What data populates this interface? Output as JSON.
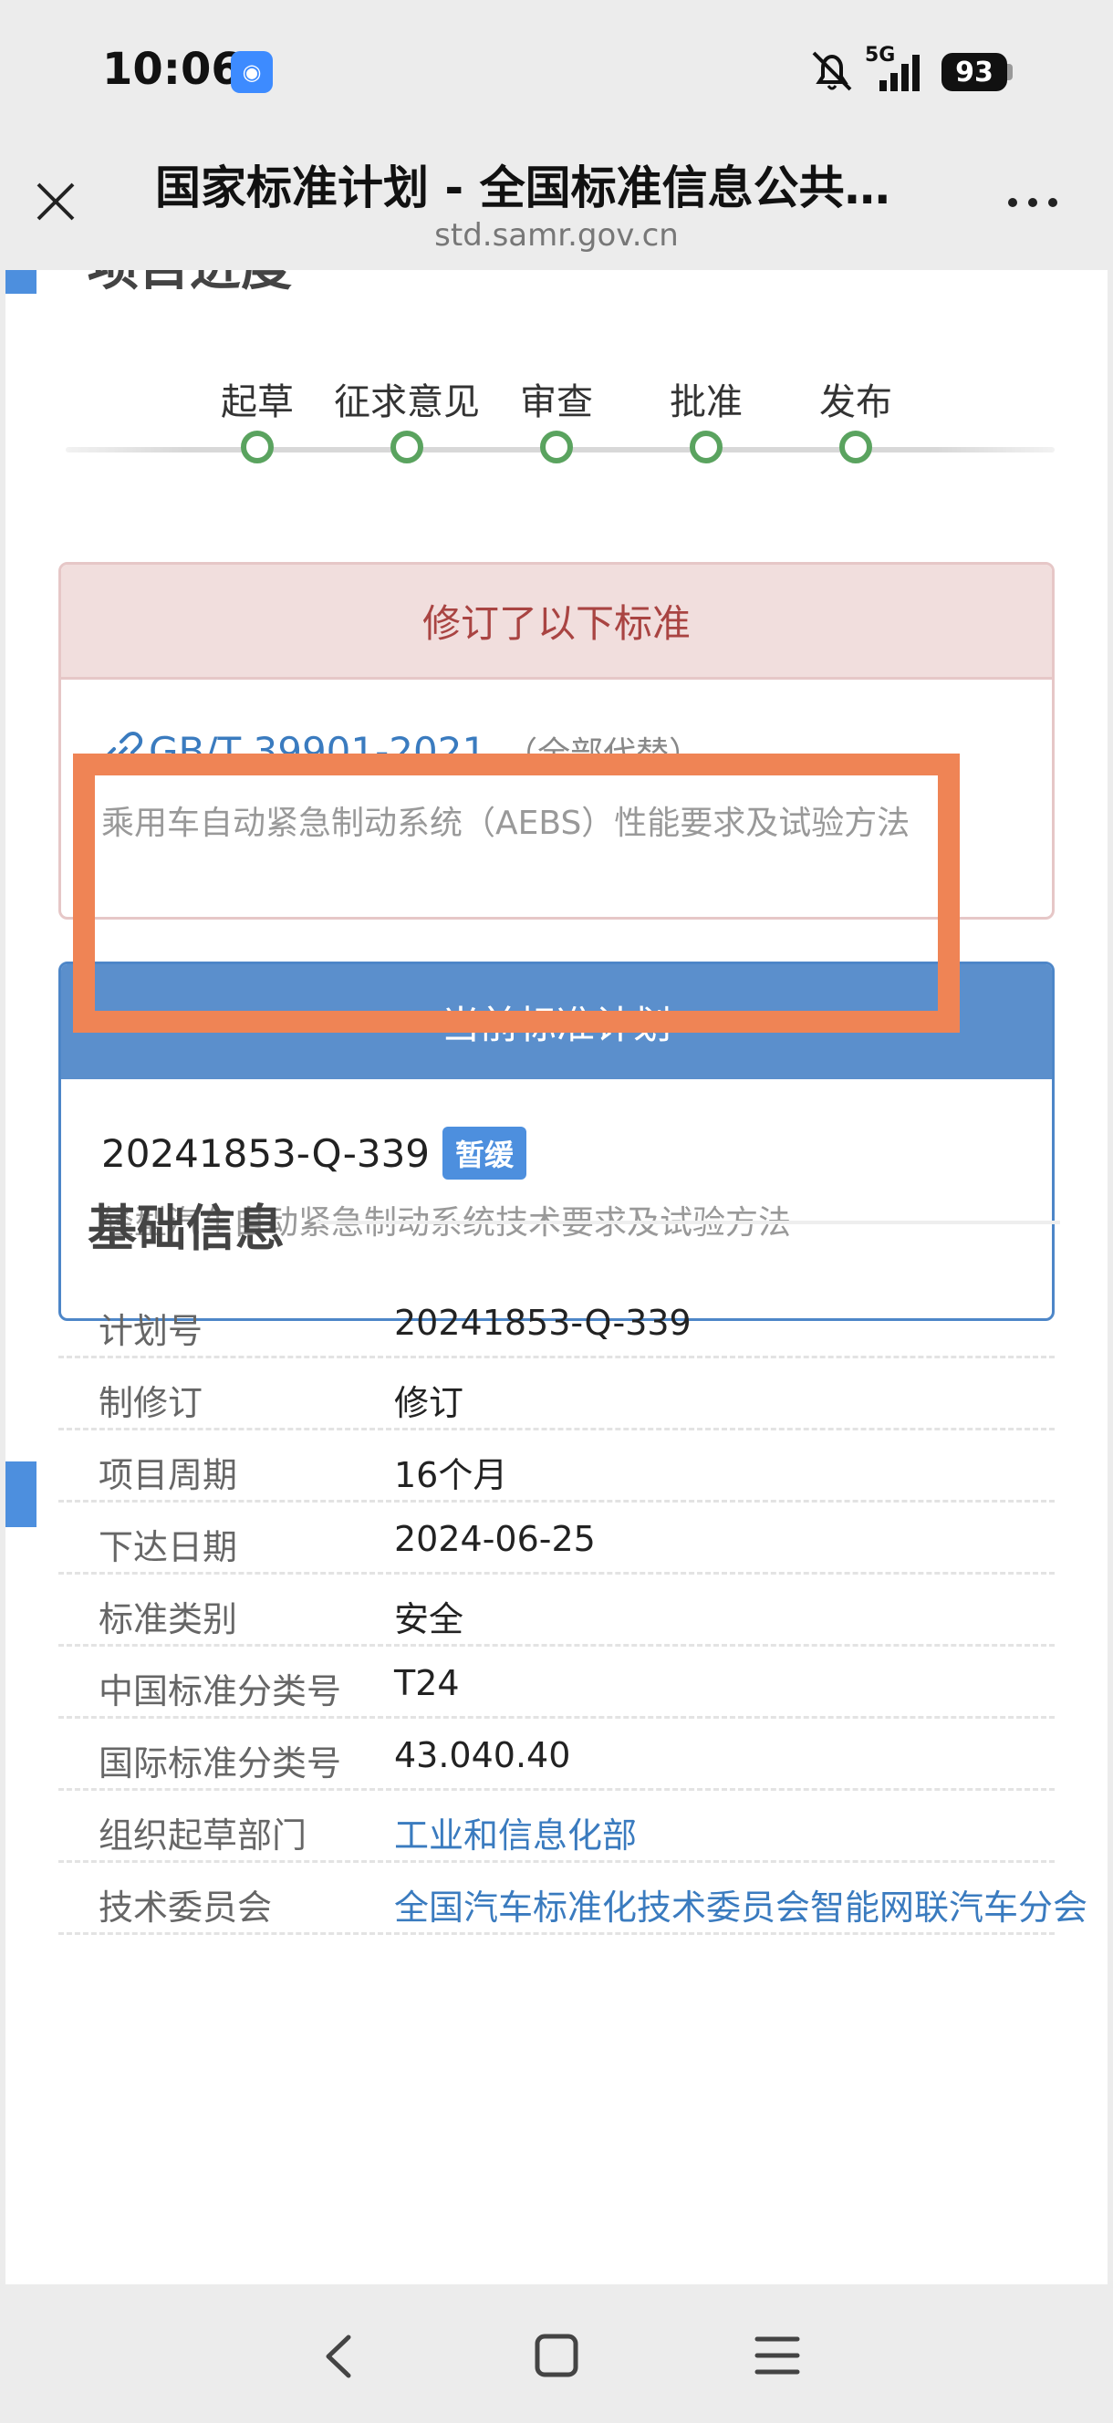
{
  "status_bar": {
    "time": "10:06",
    "network": "5G",
    "battery": "93"
  },
  "title_bar": {
    "title": "国家标准计划 - 全国标准信息公共…",
    "url": "std.samr.gov.cn"
  },
  "progress": {
    "section_title": "项目进度",
    "steps": [
      "起草",
      "征求意见",
      "审查",
      "批准",
      "发布"
    ],
    "step_color": "#5aa35f"
  },
  "revised": {
    "header": "修订了以下标准",
    "code": "GB/T 39901-2021",
    "note": "（全部代替）",
    "description": "乘用车自动紧急制动系统（AEBS）性能要求及试验方法"
  },
  "current_plan": {
    "header": "当前标准计划",
    "code": "20241853-Q-339",
    "badge": "暂缓",
    "description": "轻型汽车自动紧急制动系统技术要求及试验方法"
  },
  "basic_info": {
    "title": "基础信息",
    "rows": [
      {
        "key": "计划号",
        "value": "20241853-Q-339"
      },
      {
        "key": "制修订",
        "value": "修订"
      },
      {
        "key": "项目周期",
        "value": "16个月"
      },
      {
        "key": "下达日期",
        "value": "2024-06-25"
      },
      {
        "key": "标准类别",
        "value": "安全"
      },
      {
        "key": "中国标准分类号",
        "value": "T24"
      },
      {
        "key": "国际标准分类号",
        "value": "43.040.40"
      },
      {
        "key": "组织起草部门",
        "value": "工业和信息化部"
      },
      {
        "key": "技术委员会",
        "value": "全国汽车标准化技术委员会智能网联汽车分会"
      }
    ]
  },
  "colors": {
    "accent": "#4d8fde",
    "highlight": "#ef8455",
    "link": "#3a7bbf",
    "revised_header_text": "#a94442"
  }
}
